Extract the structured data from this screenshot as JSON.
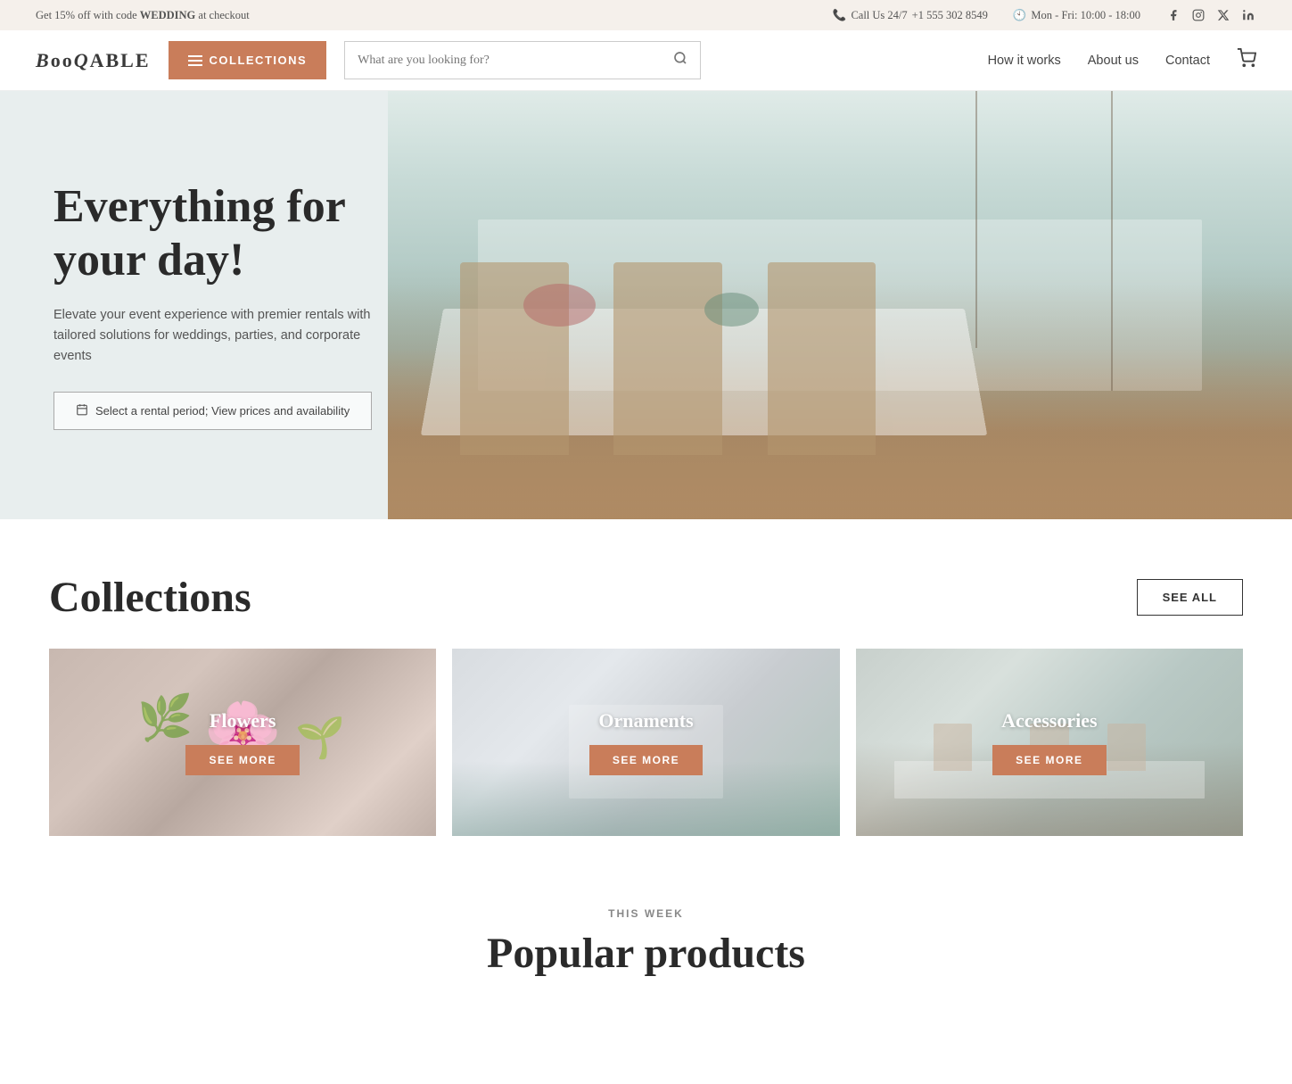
{
  "topbar": {
    "promo_text": "Get 15% off with code ",
    "promo_code": "WEDDING",
    "promo_suffix": " at checkout",
    "phone_label": "Call Us 24/7",
    "phone_number": "+1 555 302 8549",
    "hours": "Mon - Fri: 10:00 - 18:00"
  },
  "header": {
    "logo_text": "BOOQABLE",
    "collections_btn": "COLLECTIONS",
    "search_placeholder": "What are you looking for?",
    "nav": {
      "how_it_works": "How it works",
      "about_us": "About us",
      "contact": "Contact"
    }
  },
  "hero": {
    "title_line1": "Everything for",
    "title_line2": "your day!",
    "subtitle": "Elevate your event experience with premier rentals with tailored solutions for weddings, parties, and corporate events",
    "cta_label": "Select a rental period; View prices and availability"
  },
  "collections_section": {
    "title": "Collections",
    "see_all": "SEE ALL",
    "items": [
      {
        "name": "Flowers",
        "see_more": "SEE MORE",
        "card_type": "flowers"
      },
      {
        "name": "Ornaments",
        "see_more": "SEE MORE",
        "card_type": "ornaments"
      },
      {
        "name": "Accessories",
        "see_more": "SEE MORE",
        "card_type": "accessories"
      }
    ]
  },
  "this_week": {
    "label": "THIS WEEK",
    "title": "Popular products"
  },
  "social": {
    "facebook": "f",
    "instagram": "📷",
    "x": "✕",
    "linkedin": "in"
  }
}
